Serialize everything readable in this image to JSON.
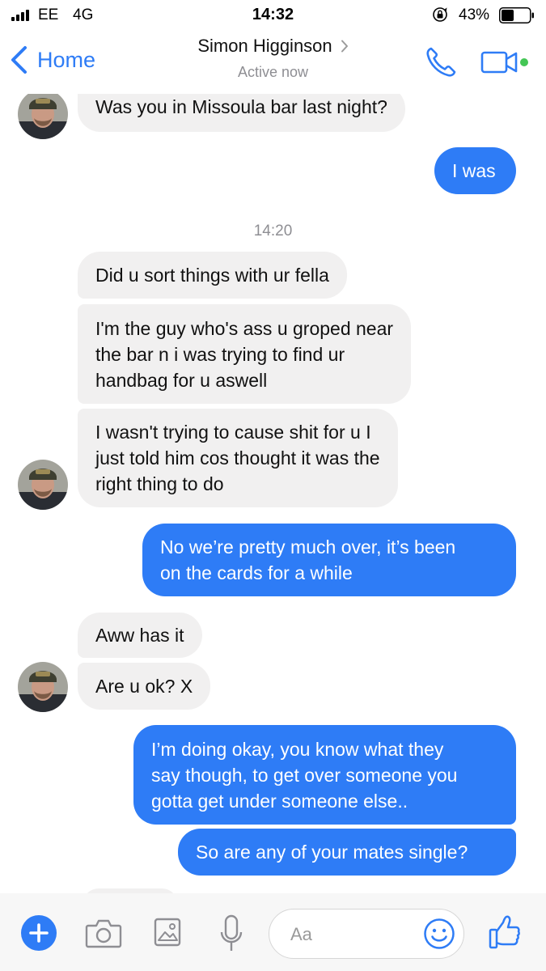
{
  "status_bar": {
    "carrier": "EE",
    "network": "4G",
    "time": "14:32",
    "battery_percent": "43%",
    "battery_level": 0.43
  },
  "header": {
    "back_label": "Home",
    "contact_name": "Simon Higginson",
    "contact_status": "Active now",
    "online_color": "#44c655"
  },
  "colors": {
    "accent": "#2e7cf6",
    "incoming_bubble": "#f1f0f0",
    "timestamp_text": "#8e8e93"
  },
  "conversation": {
    "timestamp": "14:20",
    "messages": [
      {
        "direction": "incoming",
        "lines": [
          "Was you in Missoula bar last night?"
        ]
      },
      {
        "direction": "outgoing",
        "lines": [
          "I was"
        ]
      },
      {
        "direction": "incoming",
        "lines": [
          "Did u sort things with ur fella"
        ]
      },
      {
        "direction": "incoming",
        "lines": [
          "I'm the guy who's ass u groped near",
          "the bar n i was trying to find ur",
          "handbag for u aswell"
        ]
      },
      {
        "direction": "incoming",
        "lines": [
          "I wasn't trying to cause shit for u I",
          "just told him cos thought it was the",
          "right thing to do"
        ]
      },
      {
        "direction": "outgoing",
        "lines": [
          "No we’re pretty much over, it’s been",
          "on the cards for a while"
        ]
      },
      {
        "direction": "incoming",
        "lines": [
          "Aww has it"
        ]
      },
      {
        "direction": "incoming",
        "lines": [
          "Are u ok? X"
        ]
      },
      {
        "direction": "outgoing",
        "lines": [
          "I’m doing okay, you know what they",
          "say though, to get over someone you",
          "gotta get under someone else.."
        ]
      },
      {
        "direction": "outgoing",
        "lines": [
          "So are any of your mates single?"
        ]
      }
    ]
  },
  "composer": {
    "placeholder": "Aa",
    "icons": [
      "plus-icon",
      "camera-icon",
      "image-icon",
      "microphone-icon",
      "smile-icon",
      "thumbs-up-icon"
    ]
  }
}
